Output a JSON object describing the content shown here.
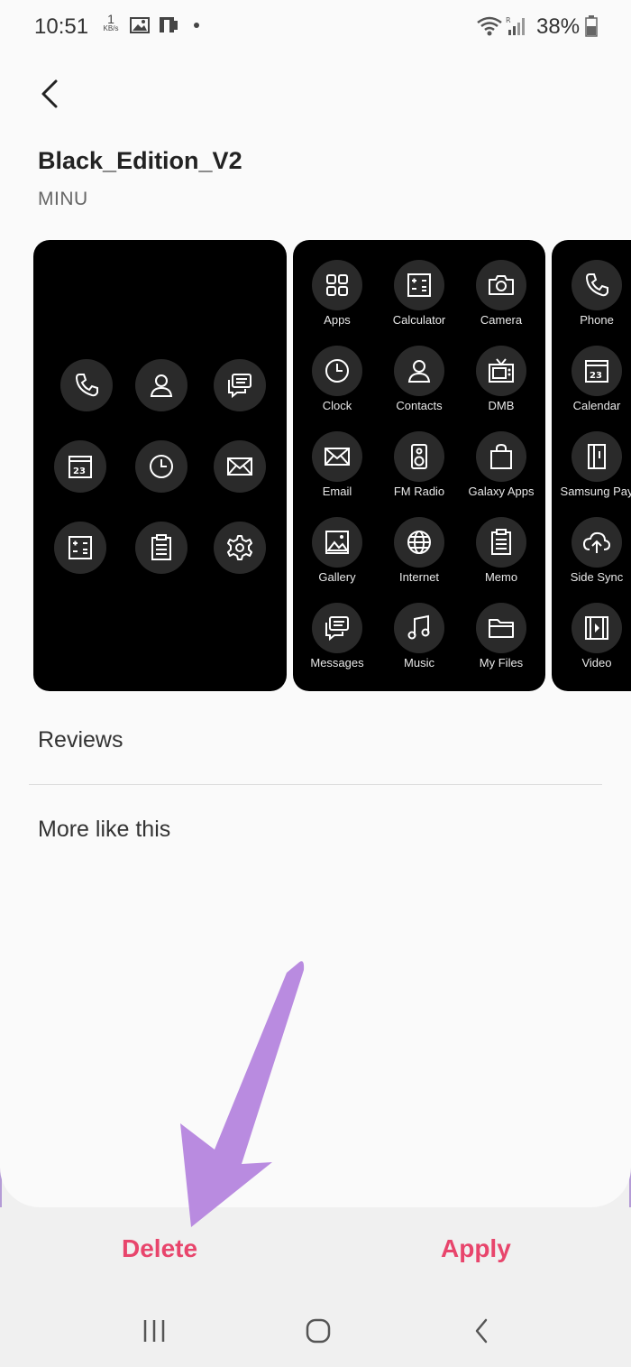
{
  "status_bar": {
    "time": "10:51",
    "net_speed_value": "1",
    "net_speed_unit": "KB/s",
    "battery": "38%"
  },
  "theme": {
    "title": "Black_Edition_V2",
    "author": "MINU"
  },
  "preview_pages": {
    "page2_apps": [
      "Apps",
      "Calculator",
      "Camera",
      "Clock",
      "Contacts",
      "DMB",
      "Email",
      "FM Radio",
      "Galaxy Apps",
      "Gallery",
      "Internet",
      "Memo",
      "Messages",
      "Music",
      "My Files"
    ],
    "page3_apps": [
      "Phone",
      "Calendar",
      "Samsung Pay",
      "Side Sync",
      "Video"
    ]
  },
  "sections": {
    "reviews": "Reviews",
    "more_like_this": "More like this"
  },
  "actions": {
    "delete": "Delete",
    "apply": "Apply"
  },
  "colors": {
    "accent": "#e8456c",
    "annotation_arrow": "#b98be0"
  }
}
